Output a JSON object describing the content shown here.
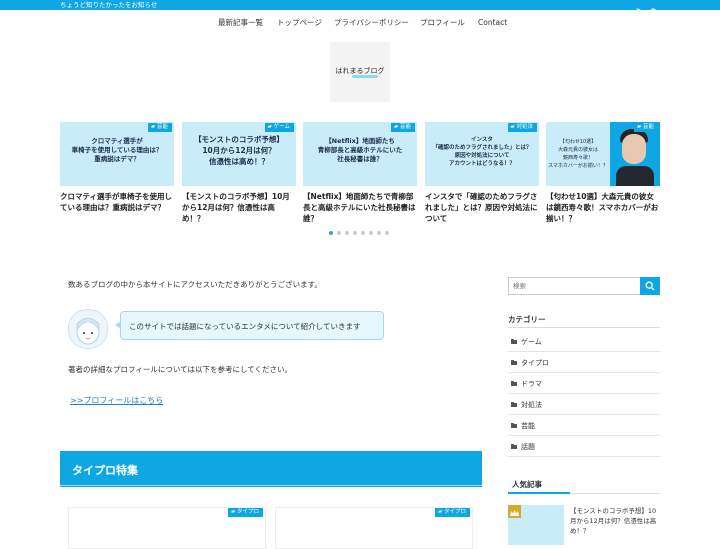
{
  "topbar": {
    "tagline": "ちょうど知りたかったをお知らせ",
    "icons": [
      "rss-icon",
      "search-icon"
    ]
  },
  "nav": [
    "最新記事一覧",
    "トップページ",
    "プライバシーポリシー",
    "プロフィール",
    "Contact"
  ],
  "logo": {
    "text": "はれまるブログ"
  },
  "carousel": [
    {
      "badge": "芸能",
      "thumb": "クロマティ選手が\n車椅子を使用している理由は？\n重病説はデマ？",
      "title": "クロマティ選手が車椅子を使用している理由は？重病説はデマ？"
    },
    {
      "badge": "ゲーム",
      "thumb": "【モンストのコラボ予想】\n10月から12月は何？\n信憑性は高め！？",
      "title": "【モンストのコラボ予想】10月から12月は何？信憑性は高め！？"
    },
    {
      "badge": "芸能",
      "thumb": "【Netflix】地面師たち\n青柳部長と高級ホテルにいた\n社長秘書は誰？",
      "title": "【Netflix】地面師たちで青柳部長と高級ホテルにいた社長秘書は誰？"
    },
    {
      "badge": "対処法",
      "thumb": "インスタ\n「確認のためフラグされました」とは？\n原因や対処法について\nアカウントはどうなる！？",
      "title": "インスタで「確認のためフラグされました」とは？原因や対処法について"
    },
    {
      "badge": "芸能",
      "thumb": "【匂わせ10選】\n大森元貴の彼女は\n鏡西寿々歌！\nスマホカバーがお揃い！？",
      "title": "【匂わせ10選】大森元貴の彼女は鏡西寿々歌！スマホカバーがお揃い！？"
    }
  ],
  "carousel_dots": {
    "count": 8,
    "active": 1
  },
  "main": {
    "intro": "数あるブログの中から本サイトにアクセスいただきありがとうございます。",
    "bubble": "このサイトでは話題になっているエンタメについて紹介していきます",
    "detail": "著者の詳細なプロフィールについては以下を参考にしてください。",
    "profile_link": ">>プロフィールはこちら",
    "section_title": "タイプロ特集",
    "section_cards": [
      {
        "badge": "タイプロ"
      },
      {
        "badge": "タイプロ"
      }
    ]
  },
  "sidebar": {
    "search_placeholder": "検索",
    "category_heading": "カテゴリー",
    "categories": [
      "ゲーム",
      "タイプロ",
      "ドラマ",
      "対処法",
      "芸能",
      "話題"
    ],
    "popular_heading": "人気記事",
    "popular": [
      {
        "rank": "1",
        "title": "【モンストのコラボ予想】10月から12月は何？信憑性は高め！？"
      }
    ]
  },
  "colors": {
    "accent": "#0fa7e3",
    "link": "#1a80c7",
    "thumb_bg": "#c9ecf9"
  }
}
